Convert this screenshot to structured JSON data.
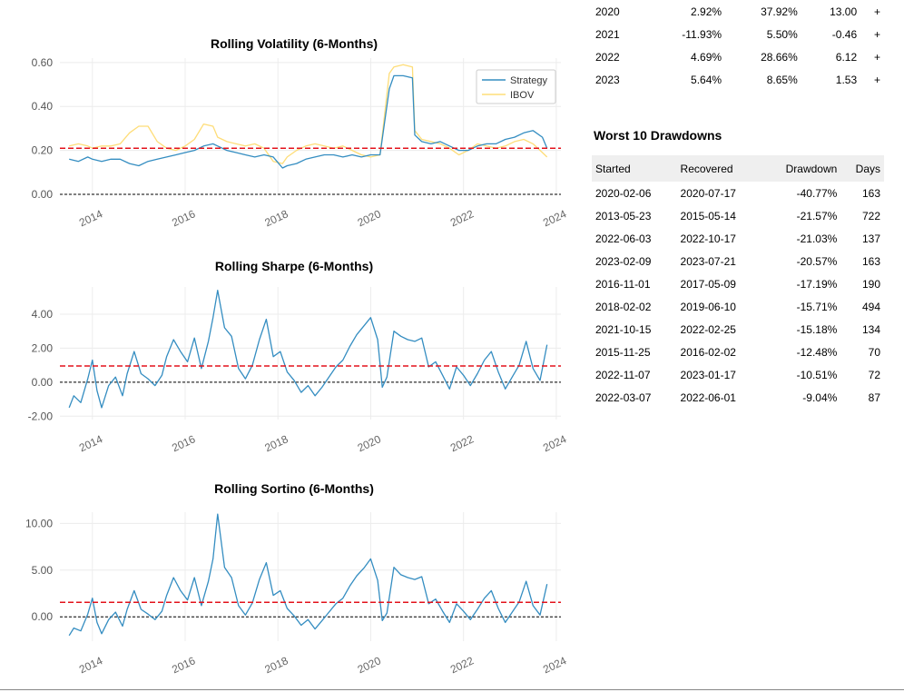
{
  "yearly_returns": {
    "rows": [
      {
        "year": "2020",
        "strategy": "2.92%",
        "benchmark": "37.92%",
        "multiplier": "13.00",
        "won": "+"
      },
      {
        "year": "2021",
        "strategy": "-11.93%",
        "benchmark": "5.50%",
        "multiplier": "-0.46",
        "won": "+"
      },
      {
        "year": "2022",
        "strategy": "4.69%",
        "benchmark": "28.66%",
        "multiplier": "6.12",
        "won": "+"
      },
      {
        "year": "2023",
        "strategy": "5.64%",
        "benchmark": "8.65%",
        "multiplier": "1.53",
        "won": "+"
      }
    ]
  },
  "drawdowns": {
    "title": "Worst 10 Drawdowns",
    "headers": [
      "Started",
      "Recovered",
      "Drawdown",
      "Days"
    ],
    "rows": [
      [
        "2020-02-06",
        "2020-07-17",
        "-40.77%",
        "163"
      ],
      [
        "2013-05-23",
        "2015-05-14",
        "-21.57%",
        "722"
      ],
      [
        "2022-06-03",
        "2022-10-17",
        "-21.03%",
        "137"
      ],
      [
        "2023-02-09",
        "2023-07-21",
        "-20.57%",
        "163"
      ],
      [
        "2016-11-01",
        "2017-05-09",
        "-17.19%",
        "190"
      ],
      [
        "2018-02-02",
        "2019-06-10",
        "-15.71%",
        "494"
      ],
      [
        "2021-10-15",
        "2022-02-25",
        "-15.18%",
        "134"
      ],
      [
        "2015-11-25",
        "2016-02-02",
        "-12.48%",
        "70"
      ],
      [
        "2022-11-07",
        "2023-01-17",
        "-10.51%",
        "72"
      ],
      [
        "2022-03-07",
        "2022-06-01",
        "-9.04%",
        "87"
      ]
    ]
  },
  "chart_data": [
    {
      "type": "line",
      "title": "Rolling Volatility (6-Months)",
      "xlabel": "",
      "ylabel": "",
      "xlim": [
        2013.3,
        2024.1
      ],
      "ylim": [
        0.0,
        0.62
      ],
      "x_ticks": [
        2014,
        2016,
        2018,
        2020,
        2022,
        2024
      ],
      "x_tick_labels": [
        "2014",
        "2016",
        "2018",
        "2020",
        "2022",
        "2024"
      ],
      "y_ticks": [
        0.0,
        0.2,
        0.4,
        0.6
      ],
      "y_tick_labels": [
        "0.00",
        "0.20",
        "0.40",
        "0.60"
      ],
      "mean_line": 0.21,
      "zero_line": 0.0,
      "legend": "top-right",
      "grid": true,
      "series": [
        {
          "name": "Strategy",
          "color": "#348dc1",
          "x": [
            2013.5,
            2013.7,
            2013.9,
            2014.0,
            2014.2,
            2014.4,
            2014.6,
            2014.8,
            2015.0,
            2015.2,
            2015.4,
            2015.6,
            2015.8,
            2016.0,
            2016.2,
            2016.4,
            2016.6,
            2016.7,
            2016.9,
            2017.1,
            2017.3,
            2017.5,
            2017.7,
            2017.9,
            2018.1,
            2018.2,
            2018.4,
            2018.6,
            2018.8,
            2019.0,
            2019.2,
            2019.4,
            2019.6,
            2019.8,
            2020.0,
            2020.2,
            2020.4,
            2020.5,
            2020.7,
            2020.9,
            2020.95,
            2021.1,
            2021.3,
            2021.5,
            2021.7,
            2021.9,
            2022.1,
            2022.3,
            2022.5,
            2022.7,
            2022.9,
            2023.1,
            2023.3,
            2023.5,
            2023.7,
            2023.8
          ],
          "values": [
            0.16,
            0.15,
            0.17,
            0.16,
            0.15,
            0.16,
            0.16,
            0.14,
            0.13,
            0.15,
            0.16,
            0.17,
            0.18,
            0.19,
            0.2,
            0.22,
            0.23,
            0.22,
            0.2,
            0.19,
            0.18,
            0.17,
            0.18,
            0.17,
            0.12,
            0.13,
            0.14,
            0.16,
            0.17,
            0.18,
            0.18,
            0.17,
            0.18,
            0.17,
            0.18,
            0.18,
            0.48,
            0.54,
            0.54,
            0.53,
            0.27,
            0.24,
            0.23,
            0.24,
            0.22,
            0.2,
            0.2,
            0.22,
            0.23,
            0.23,
            0.25,
            0.26,
            0.28,
            0.29,
            0.26,
            0.21
          ]
        },
        {
          "name": "IBOV",
          "color": "#fedd78",
          "x": [
            2013.5,
            2013.7,
            2013.9,
            2014.0,
            2014.2,
            2014.4,
            2014.6,
            2014.8,
            2015.0,
            2015.2,
            2015.4,
            2015.6,
            2015.8,
            2016.0,
            2016.2,
            2016.4,
            2016.6,
            2016.7,
            2016.9,
            2017.1,
            2017.3,
            2017.5,
            2017.7,
            2017.9,
            2018.1,
            2018.2,
            2018.4,
            2018.6,
            2018.8,
            2019.0,
            2019.2,
            2019.4,
            2019.6,
            2019.8,
            2020.0,
            2020.2,
            2020.4,
            2020.5,
            2020.7,
            2020.9,
            2020.95,
            2021.1,
            2021.3,
            2021.5,
            2021.7,
            2021.9,
            2022.1,
            2022.3,
            2022.5,
            2022.7,
            2022.9,
            2023.1,
            2023.3,
            2023.5,
            2023.7,
            2023.8
          ],
          "values": [
            0.22,
            0.23,
            0.22,
            0.21,
            0.22,
            0.22,
            0.23,
            0.28,
            0.31,
            0.31,
            0.24,
            0.21,
            0.2,
            0.22,
            0.25,
            0.32,
            0.31,
            0.26,
            0.24,
            0.23,
            0.22,
            0.23,
            0.21,
            0.15,
            0.14,
            0.17,
            0.2,
            0.22,
            0.23,
            0.22,
            0.21,
            0.22,
            0.2,
            0.18,
            0.17,
            0.18,
            0.55,
            0.58,
            0.59,
            0.58,
            0.29,
            0.25,
            0.24,
            0.23,
            0.21,
            0.18,
            0.2,
            0.23,
            0.22,
            0.21,
            0.22,
            0.24,
            0.25,
            0.23,
            0.19,
            0.17
          ]
        }
      ]
    },
    {
      "type": "line",
      "title": "Rolling Sharpe (6-Months)",
      "xlabel": "",
      "ylabel": "",
      "xlim": [
        2013.3,
        2024.1
      ],
      "ylim": [
        -2.2,
        5.6
      ],
      "x_ticks": [
        2014,
        2016,
        2018,
        2020,
        2022,
        2024
      ],
      "x_tick_labels": [
        "2014",
        "2016",
        "2018",
        "2020",
        "2022",
        "2024"
      ],
      "y_ticks": [
        -2.0,
        0.0,
        2.0,
        4.0
      ],
      "y_tick_labels": [
        "-2.00",
        "0.00",
        "2.00",
        "4.00"
      ],
      "mean_line": 0.95,
      "zero_line": 0.0,
      "grid": true,
      "series": [
        {
          "name": "Strategy",
          "color": "#348dc1",
          "x": [
            2013.5,
            2013.6,
            2013.75,
            2013.9,
            2014.0,
            2014.1,
            2014.2,
            2014.35,
            2014.5,
            2014.65,
            2014.75,
            2014.9,
            2015.05,
            2015.2,
            2015.35,
            2015.5,
            2015.6,
            2015.75,
            2015.9,
            2016.05,
            2016.2,
            2016.35,
            2016.5,
            2016.6,
            2016.7,
            2016.85,
            2017.0,
            2017.15,
            2017.3,
            2017.45,
            2017.6,
            2017.75,
            2017.9,
            2018.05,
            2018.2,
            2018.35,
            2018.5,
            2018.65,
            2018.8,
            2018.95,
            2019.1,
            2019.25,
            2019.4,
            2019.55,
            2019.7,
            2019.85,
            2020.0,
            2020.15,
            2020.25,
            2020.35,
            2020.5,
            2020.65,
            2020.8,
            2020.95,
            2021.1,
            2021.25,
            2021.4,
            2021.55,
            2021.7,
            2021.85,
            2022.0,
            2022.15,
            2022.3,
            2022.45,
            2022.6,
            2022.75,
            2022.9,
            2023.05,
            2023.2,
            2023.35,
            2023.5,
            2023.65,
            2023.8
          ],
          "values": [
            -1.5,
            -0.8,
            -1.2,
            0.2,
            1.3,
            -0.5,
            -1.5,
            -0.2,
            0.3,
            -0.8,
            0.5,
            1.8,
            0.5,
            0.2,
            -0.2,
            0.4,
            1.5,
            2.5,
            1.8,
            1.2,
            2.6,
            0.8,
            2.4,
            3.8,
            5.4,
            3.2,
            2.7,
            0.8,
            0.2,
            1.0,
            2.5,
            3.7,
            1.5,
            1.8,
            0.6,
            0.1,
            -0.6,
            -0.2,
            -0.8,
            -0.3,
            0.3,
            0.9,
            1.3,
            2.1,
            2.8,
            3.3,
            3.8,
            2.5,
            -0.3,
            0.3,
            3.0,
            2.7,
            2.5,
            2.4,
            2.6,
            0.9,
            1.2,
            0.4,
            -0.4,
            0.9,
            0.4,
            -0.2,
            0.5,
            1.3,
            1.8,
            0.6,
            -0.4,
            0.3,
            1.0,
            2.4,
            0.8,
            0.1,
            2.2
          ]
        }
      ]
    },
    {
      "type": "line",
      "title": "Rolling Sortino (6-Months)",
      "xlabel": "",
      "ylabel": "",
      "xlim": [
        2013.3,
        2024.1
      ],
      "ylim": [
        -2.6,
        11.2
      ],
      "x_ticks": [
        2014,
        2016,
        2018,
        2020,
        2022,
        2024
      ],
      "x_tick_labels": [
        "2014",
        "2016",
        "2018",
        "2020",
        "2022",
        "2024"
      ],
      "y_ticks": [
        0.0,
        5.0,
        10.0
      ],
      "y_tick_labels": [
        "0.00",
        "5.00",
        "10.00"
      ],
      "mean_line": 1.55,
      "zero_line": 0.0,
      "grid": true,
      "series": [
        {
          "name": "Strategy",
          "color": "#348dc1",
          "x": [
            2013.5,
            2013.6,
            2013.75,
            2013.9,
            2014.0,
            2014.1,
            2014.2,
            2014.35,
            2014.5,
            2014.65,
            2014.75,
            2014.9,
            2015.05,
            2015.2,
            2015.35,
            2015.5,
            2015.6,
            2015.75,
            2015.9,
            2016.05,
            2016.2,
            2016.35,
            2016.5,
            2016.6,
            2016.7,
            2016.85,
            2017.0,
            2017.15,
            2017.3,
            2017.45,
            2017.6,
            2017.75,
            2017.9,
            2018.05,
            2018.2,
            2018.35,
            2018.5,
            2018.65,
            2018.8,
            2018.95,
            2019.1,
            2019.25,
            2019.4,
            2019.55,
            2019.7,
            2019.85,
            2020.0,
            2020.15,
            2020.25,
            2020.35,
            2020.5,
            2020.65,
            2020.8,
            2020.95,
            2021.1,
            2021.25,
            2021.4,
            2021.55,
            2021.7,
            2021.85,
            2022.0,
            2022.15,
            2022.3,
            2022.45,
            2022.6,
            2022.75,
            2022.9,
            2023.05,
            2023.2,
            2023.35,
            2023.5,
            2023.65,
            2023.8
          ],
          "values": [
            -2.0,
            -1.2,
            -1.5,
            0.3,
            2.0,
            -0.6,
            -1.8,
            -0.3,
            0.5,
            -1.0,
            0.8,
            2.8,
            0.8,
            0.3,
            -0.3,
            0.6,
            2.3,
            4.2,
            2.8,
            1.8,
            4.2,
            1.2,
            3.8,
            6.2,
            11.0,
            5.3,
            4.2,
            1.2,
            0.2,
            1.5,
            4.0,
            5.8,
            2.3,
            2.8,
            0.9,
            0.1,
            -0.9,
            -0.3,
            -1.3,
            -0.4,
            0.5,
            1.4,
            2.0,
            3.3,
            4.4,
            5.2,
            6.2,
            3.9,
            -0.4,
            0.4,
            5.3,
            4.5,
            4.2,
            4.0,
            4.3,
            1.4,
            1.9,
            0.6,
            -0.6,
            1.4,
            0.6,
            -0.3,
            0.8,
            2.0,
            2.8,
            0.9,
            -0.6,
            0.5,
            1.6,
            3.8,
            1.2,
            0.2,
            3.5
          ]
        }
      ]
    }
  ]
}
